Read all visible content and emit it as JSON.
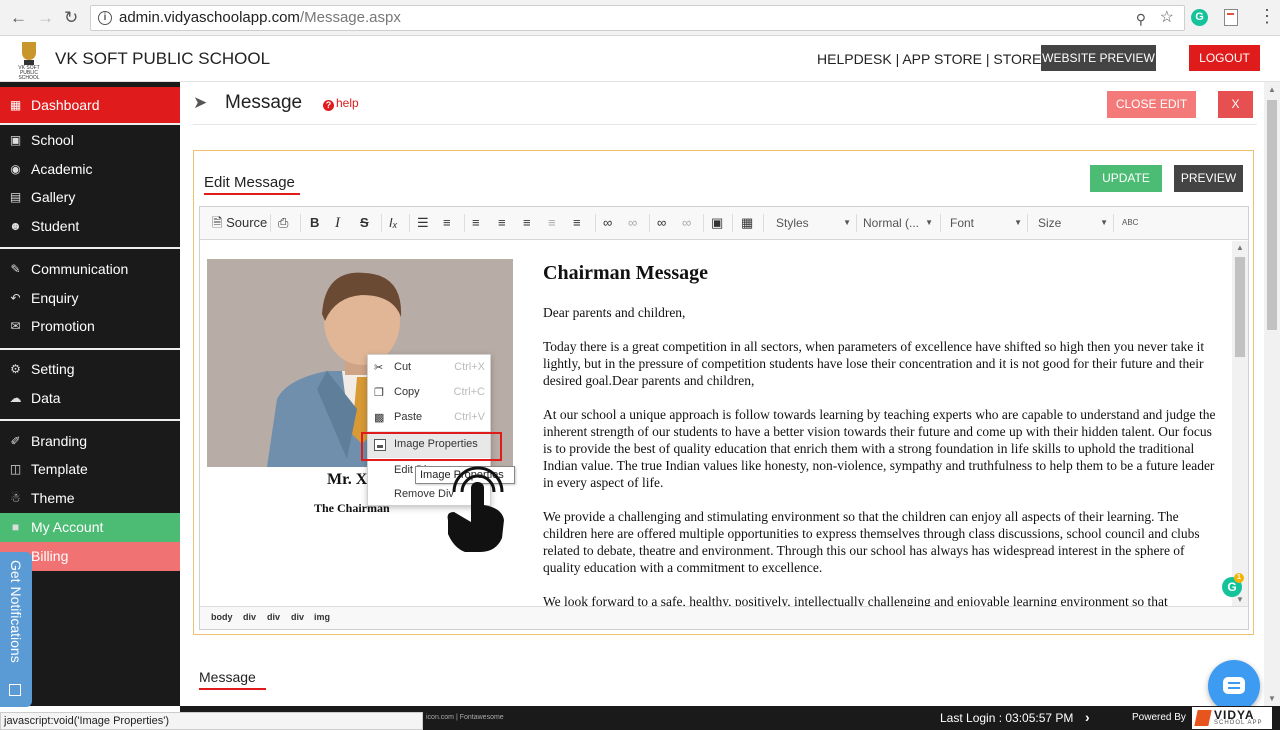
{
  "browser": {
    "url_host": "admin.vidyaschoolapp.com",
    "url_path": "/Message.aspx",
    "status_text": "javascript:void('Image Properties')"
  },
  "header": {
    "school_name": "VK SOFT PUBLIC SCHOOL",
    "links": "HELPDESK | APP STORE | STORE",
    "website_preview": "WEBSITE PREVIEW",
    "logout": "LOGOUT",
    "logo_text": "VK SOFT PUBLIC SCHOOL"
  },
  "sidebar": {
    "items": [
      {
        "label": "Dashboard",
        "icon": "dashboard-icon"
      },
      {
        "label": "School",
        "icon": "school-icon"
      },
      {
        "label": "Academic",
        "icon": "globe-icon"
      },
      {
        "label": "Gallery",
        "icon": "image-icon"
      },
      {
        "label": "Student",
        "icon": "student-icon"
      },
      {
        "label": "Communication",
        "icon": "communication-icon"
      },
      {
        "label": "Enquiry",
        "icon": "enquiry-icon"
      },
      {
        "label": "Promotion",
        "icon": "promotion-icon"
      },
      {
        "label": "Setting",
        "icon": "gear-icon"
      },
      {
        "label": "Data",
        "icon": "data-icon"
      },
      {
        "label": "Branding",
        "icon": "branding-icon"
      },
      {
        "label": "Template",
        "icon": "template-icon"
      },
      {
        "label": "Theme",
        "icon": "theme-icon"
      },
      {
        "label": "My Account",
        "icon": "account-icon"
      },
      {
        "label": "Billing",
        "icon": "billing-icon"
      }
    ],
    "notifications_tab": "Get Notifications"
  },
  "main": {
    "title": "Message",
    "help": "help",
    "close_edit": "CLOSE EDIT",
    "close_x": "X",
    "panel_title": "Edit Message",
    "update": "UPDATE",
    "preview": "PREVIEW",
    "section_label": "Message"
  },
  "toolbar": {
    "source": "Source",
    "styles": "Styles",
    "format": "Normal (...",
    "font": "Font",
    "size": "Size",
    "spell": "ABC"
  },
  "content": {
    "caption_name": "Mr. X",
    "caption_role": "The Chairman",
    "heading": "Chairman Message",
    "p1": "Dear parents and children,",
    "p2": "Today there is a great competition in all sectors, when parameters of excellence have shifted so high then you never take it lightly, but in the pressure of competition students have lose their concentration and it is not good for their future and their desired goal.Dear parents and children,",
    "p3": "At our school a unique approach is follow towards learning by teaching experts who are capable to understand and judge the inherent strength of our students to have a better vision towards their future and come up with their hidden talent. Our focus is to provide the best of quality education that enrich them with a strong foundation in life skills to uphold the traditional Indian value. The true Indian values like honesty, non-violence, sympathy and truthfulness to help them to be a future leader in every aspect of life.",
    "p4": "We provide a challenging and stimulating environment so that the children can enjoy all aspects of their learning. The children here are offered multiple opportunities to express themselves through class discussions, school council and clubs related to debate, theatre and environment. Through this our school has always has widespread interest in the sphere of quality education with a commitment to excellence.",
    "p5": "We look forward to a safe, healthy, positively, intellectually challenging and enjoyable learning environment so that"
  },
  "pathbar": [
    "body",
    "div",
    "div",
    "div",
    "img"
  ],
  "context_menu": {
    "cut": "Cut",
    "cut_sc": "Ctrl+X",
    "copy": "Copy",
    "copy_sc": "Ctrl+C",
    "paste": "Paste",
    "paste_sc": "Ctrl+V",
    "image_properties": "Image Properties",
    "edit_div": "Edit Div",
    "remove_div": "Remove Div",
    "tooltip": "Image Properties"
  },
  "footer": {
    "credits": "icon.com | Fontawesome",
    "last_login": "Last Login : 03:05:57 PM",
    "powered_by": "Powered By",
    "brand": "VIDYA",
    "brand_sub": "SCHOOL APP"
  },
  "colors": {
    "accent_red": "#e01b1b",
    "green": "#4cbc74",
    "sidebar_bg": "#1a1a1a",
    "billing": "#f07272"
  }
}
